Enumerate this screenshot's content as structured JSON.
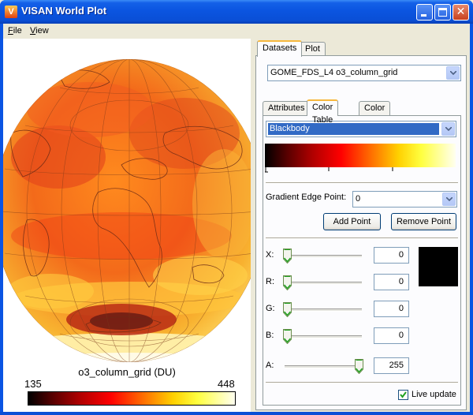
{
  "window": {
    "title": "VISAN World Plot",
    "app_icon_glyph": "V",
    "minimize_icon": "minimize-icon",
    "maximize_icon": "maximize-icon",
    "close_glyph": "✕"
  },
  "menu": [
    {
      "underline": "F",
      "rest": "ile"
    },
    {
      "underline": "V",
      "rest": "iew"
    }
  ],
  "plot": {
    "colorbar_title": "o3_column_grid (DU)",
    "colorbar_min": "135",
    "colorbar_max": "448",
    "colormap": "Blackbody"
  },
  "tabs": [
    "Datasets",
    "Plot"
  ],
  "dataset_select": "GOME_FDS_L4 o3_column_grid",
  "subtabs": [
    "Attributes",
    "Color Table",
    "Color Bar"
  ],
  "color_table": {
    "selected": "Blackbody",
    "gradient_edge_label": "Gradient Edge Point:",
    "gradient_edge_value": "0",
    "add_point_label": "Add Point",
    "remove_point_label": "Remove Point",
    "sliders": [
      {
        "label": "X:",
        "value": "0",
        "level": 0
      },
      {
        "label": "R:",
        "value": "0",
        "level": 0
      },
      {
        "label": "G:",
        "value": "0",
        "level": 0
      },
      {
        "label": "B:",
        "value": "0",
        "level": 0
      },
      {
        "label": "A:",
        "value": "255",
        "level": 1
      }
    ],
    "swatch_color": "#000000",
    "live_update_label": "Live update",
    "live_update_checked": true
  },
  "colors": {
    "titlebar": "#0b55e0",
    "accent_tab": "#f7b83e",
    "selection": "#316ac5"
  }
}
